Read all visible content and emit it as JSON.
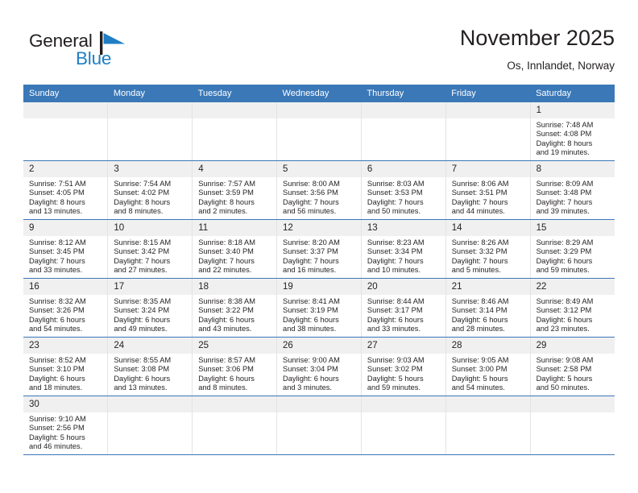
{
  "brand": {
    "name_part1": "General",
    "name_part2": "Blue",
    "logo_icon": "blue-flag-triangle",
    "color_dark": "#231f20",
    "color_blue": "#1f7ec4"
  },
  "header": {
    "title": "November 2025",
    "subtitle": "Os, Innlandet, Norway"
  },
  "theme": {
    "header_bg": "#3a78b8",
    "daynum_bg": "#f0f0f0",
    "row_divider": "#3a78b8",
    "cell_divider": "#e4e4e4"
  },
  "weekday_headers": [
    "Sunday",
    "Monday",
    "Tuesday",
    "Wednesday",
    "Thursday",
    "Friday",
    "Saturday"
  ],
  "weeks": [
    [
      {
        "day": "",
        "lines": []
      },
      {
        "day": "",
        "lines": []
      },
      {
        "day": "",
        "lines": []
      },
      {
        "day": "",
        "lines": []
      },
      {
        "day": "",
        "lines": []
      },
      {
        "day": "",
        "lines": []
      },
      {
        "day": "1",
        "lines": [
          "Sunrise: 7:48 AM",
          "Sunset: 4:08 PM",
          "Daylight: 8 hours",
          "and 19 minutes."
        ]
      }
    ],
    [
      {
        "day": "2",
        "lines": [
          "Sunrise: 7:51 AM",
          "Sunset: 4:05 PM",
          "Daylight: 8 hours",
          "and 13 minutes."
        ]
      },
      {
        "day": "3",
        "lines": [
          "Sunrise: 7:54 AM",
          "Sunset: 4:02 PM",
          "Daylight: 8 hours",
          "and 8 minutes."
        ]
      },
      {
        "day": "4",
        "lines": [
          "Sunrise: 7:57 AM",
          "Sunset: 3:59 PM",
          "Daylight: 8 hours",
          "and 2 minutes."
        ]
      },
      {
        "day": "5",
        "lines": [
          "Sunrise: 8:00 AM",
          "Sunset: 3:56 PM",
          "Daylight: 7 hours",
          "and 56 minutes."
        ]
      },
      {
        "day": "6",
        "lines": [
          "Sunrise: 8:03 AM",
          "Sunset: 3:53 PM",
          "Daylight: 7 hours",
          "and 50 minutes."
        ]
      },
      {
        "day": "7",
        "lines": [
          "Sunrise: 8:06 AM",
          "Sunset: 3:51 PM",
          "Daylight: 7 hours",
          "and 44 minutes."
        ]
      },
      {
        "day": "8",
        "lines": [
          "Sunrise: 8:09 AM",
          "Sunset: 3:48 PM",
          "Daylight: 7 hours",
          "and 39 minutes."
        ]
      }
    ],
    [
      {
        "day": "9",
        "lines": [
          "Sunrise: 8:12 AM",
          "Sunset: 3:45 PM",
          "Daylight: 7 hours",
          "and 33 minutes."
        ]
      },
      {
        "day": "10",
        "lines": [
          "Sunrise: 8:15 AM",
          "Sunset: 3:42 PM",
          "Daylight: 7 hours",
          "and 27 minutes."
        ]
      },
      {
        "day": "11",
        "lines": [
          "Sunrise: 8:18 AM",
          "Sunset: 3:40 PM",
          "Daylight: 7 hours",
          "and 22 minutes."
        ]
      },
      {
        "day": "12",
        "lines": [
          "Sunrise: 8:20 AM",
          "Sunset: 3:37 PM",
          "Daylight: 7 hours",
          "and 16 minutes."
        ]
      },
      {
        "day": "13",
        "lines": [
          "Sunrise: 8:23 AM",
          "Sunset: 3:34 PM",
          "Daylight: 7 hours",
          "and 10 minutes."
        ]
      },
      {
        "day": "14",
        "lines": [
          "Sunrise: 8:26 AM",
          "Sunset: 3:32 PM",
          "Daylight: 7 hours",
          "and 5 minutes."
        ]
      },
      {
        "day": "15",
        "lines": [
          "Sunrise: 8:29 AM",
          "Sunset: 3:29 PM",
          "Daylight: 6 hours",
          "and 59 minutes."
        ]
      }
    ],
    [
      {
        "day": "16",
        "lines": [
          "Sunrise: 8:32 AM",
          "Sunset: 3:26 PM",
          "Daylight: 6 hours",
          "and 54 minutes."
        ]
      },
      {
        "day": "17",
        "lines": [
          "Sunrise: 8:35 AM",
          "Sunset: 3:24 PM",
          "Daylight: 6 hours",
          "and 49 minutes."
        ]
      },
      {
        "day": "18",
        "lines": [
          "Sunrise: 8:38 AM",
          "Sunset: 3:22 PM",
          "Daylight: 6 hours",
          "and 43 minutes."
        ]
      },
      {
        "day": "19",
        "lines": [
          "Sunrise: 8:41 AM",
          "Sunset: 3:19 PM",
          "Daylight: 6 hours",
          "and 38 minutes."
        ]
      },
      {
        "day": "20",
        "lines": [
          "Sunrise: 8:44 AM",
          "Sunset: 3:17 PM",
          "Daylight: 6 hours",
          "and 33 minutes."
        ]
      },
      {
        "day": "21",
        "lines": [
          "Sunrise: 8:46 AM",
          "Sunset: 3:14 PM",
          "Daylight: 6 hours",
          "and 28 minutes."
        ]
      },
      {
        "day": "22",
        "lines": [
          "Sunrise: 8:49 AM",
          "Sunset: 3:12 PM",
          "Daylight: 6 hours",
          "and 23 minutes."
        ]
      }
    ],
    [
      {
        "day": "23",
        "lines": [
          "Sunrise: 8:52 AM",
          "Sunset: 3:10 PM",
          "Daylight: 6 hours",
          "and 18 minutes."
        ]
      },
      {
        "day": "24",
        "lines": [
          "Sunrise: 8:55 AM",
          "Sunset: 3:08 PM",
          "Daylight: 6 hours",
          "and 13 minutes."
        ]
      },
      {
        "day": "25",
        "lines": [
          "Sunrise: 8:57 AM",
          "Sunset: 3:06 PM",
          "Daylight: 6 hours",
          "and 8 minutes."
        ]
      },
      {
        "day": "26",
        "lines": [
          "Sunrise: 9:00 AM",
          "Sunset: 3:04 PM",
          "Daylight: 6 hours",
          "and 3 minutes."
        ]
      },
      {
        "day": "27",
        "lines": [
          "Sunrise: 9:03 AM",
          "Sunset: 3:02 PM",
          "Daylight: 5 hours",
          "and 59 minutes."
        ]
      },
      {
        "day": "28",
        "lines": [
          "Sunrise: 9:05 AM",
          "Sunset: 3:00 PM",
          "Daylight: 5 hours",
          "and 54 minutes."
        ]
      },
      {
        "day": "29",
        "lines": [
          "Sunrise: 9:08 AM",
          "Sunset: 2:58 PM",
          "Daylight: 5 hours",
          "and 50 minutes."
        ]
      }
    ],
    [
      {
        "day": "30",
        "lines": [
          "Sunrise: 9:10 AM",
          "Sunset: 2:56 PM",
          "Daylight: 5 hours",
          "and 46 minutes."
        ]
      },
      {
        "day": "",
        "lines": []
      },
      {
        "day": "",
        "lines": []
      },
      {
        "day": "",
        "lines": []
      },
      {
        "day": "",
        "lines": []
      },
      {
        "day": "",
        "lines": []
      },
      {
        "day": "",
        "lines": []
      }
    ]
  ]
}
